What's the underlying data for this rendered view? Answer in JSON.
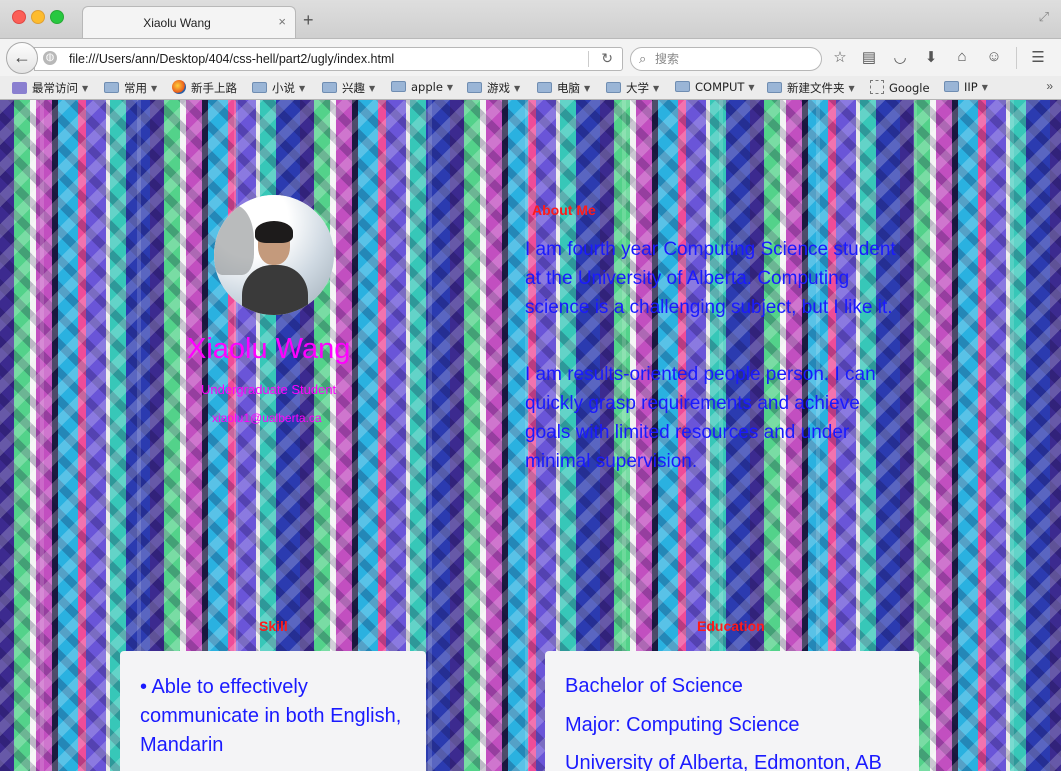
{
  "browser": {
    "tab_title": "Xiaolu Wang",
    "tab_close": "×",
    "new_tab": "+",
    "url": "file:///Users/ann/Desktop/404/css-hell/part2/ugly/index.html",
    "search_placeholder": "搜索",
    "bookmarks": [
      {
        "label": "最常访问",
        "icon": "bookmark-folder-icon"
      },
      {
        "label": "常用",
        "icon": "folder-icon"
      },
      {
        "label": "新手上路",
        "icon": "firefox-icon"
      },
      {
        "label": "小说",
        "icon": "folder-icon"
      },
      {
        "label": "兴趣",
        "icon": "folder-icon"
      },
      {
        "label": "apple",
        "icon": "folder-icon"
      },
      {
        "label": "游戏",
        "icon": "folder-icon"
      },
      {
        "label": "电脑",
        "icon": "folder-icon"
      },
      {
        "label": "大学",
        "icon": "folder-icon"
      },
      {
        "label": "COMPUT",
        "icon": "folder-icon"
      },
      {
        "label": "新建文件夹",
        "icon": "folder-icon"
      },
      {
        "label": "Google",
        "icon": "page-icon"
      },
      {
        "label": "IIP",
        "icon": "folder-icon"
      }
    ],
    "bookmarks_more": "»"
  },
  "profile": {
    "name": "Xiaolu Wang",
    "role": "Undergraduate Student",
    "email": "xiaolu1@ualberta.ca"
  },
  "about": {
    "heading": "About Me",
    "paragraph1": "I am fourth year Computing Science student at the University of Alberta. Computing science is a challenging subject, but I like it.",
    "paragraph2": "I am results-oriented people person. I can quickly grasp requirements and achieve goals with limited resources and under minimal supervision."
  },
  "skill": {
    "heading": "Skill",
    "item1": "• Able to effectively communicate in both English, Mandarin"
  },
  "education": {
    "heading": "Education",
    "degree": "Bachelor of Science",
    "major": "Major: Computing Science",
    "school": "University of Alberta, Edmonton, AB"
  },
  "colors": {
    "name": "#ff00ff",
    "headings": "#ff1a1a",
    "body_text": "#1a1aff",
    "card_bg": "#f4f4f6"
  }
}
